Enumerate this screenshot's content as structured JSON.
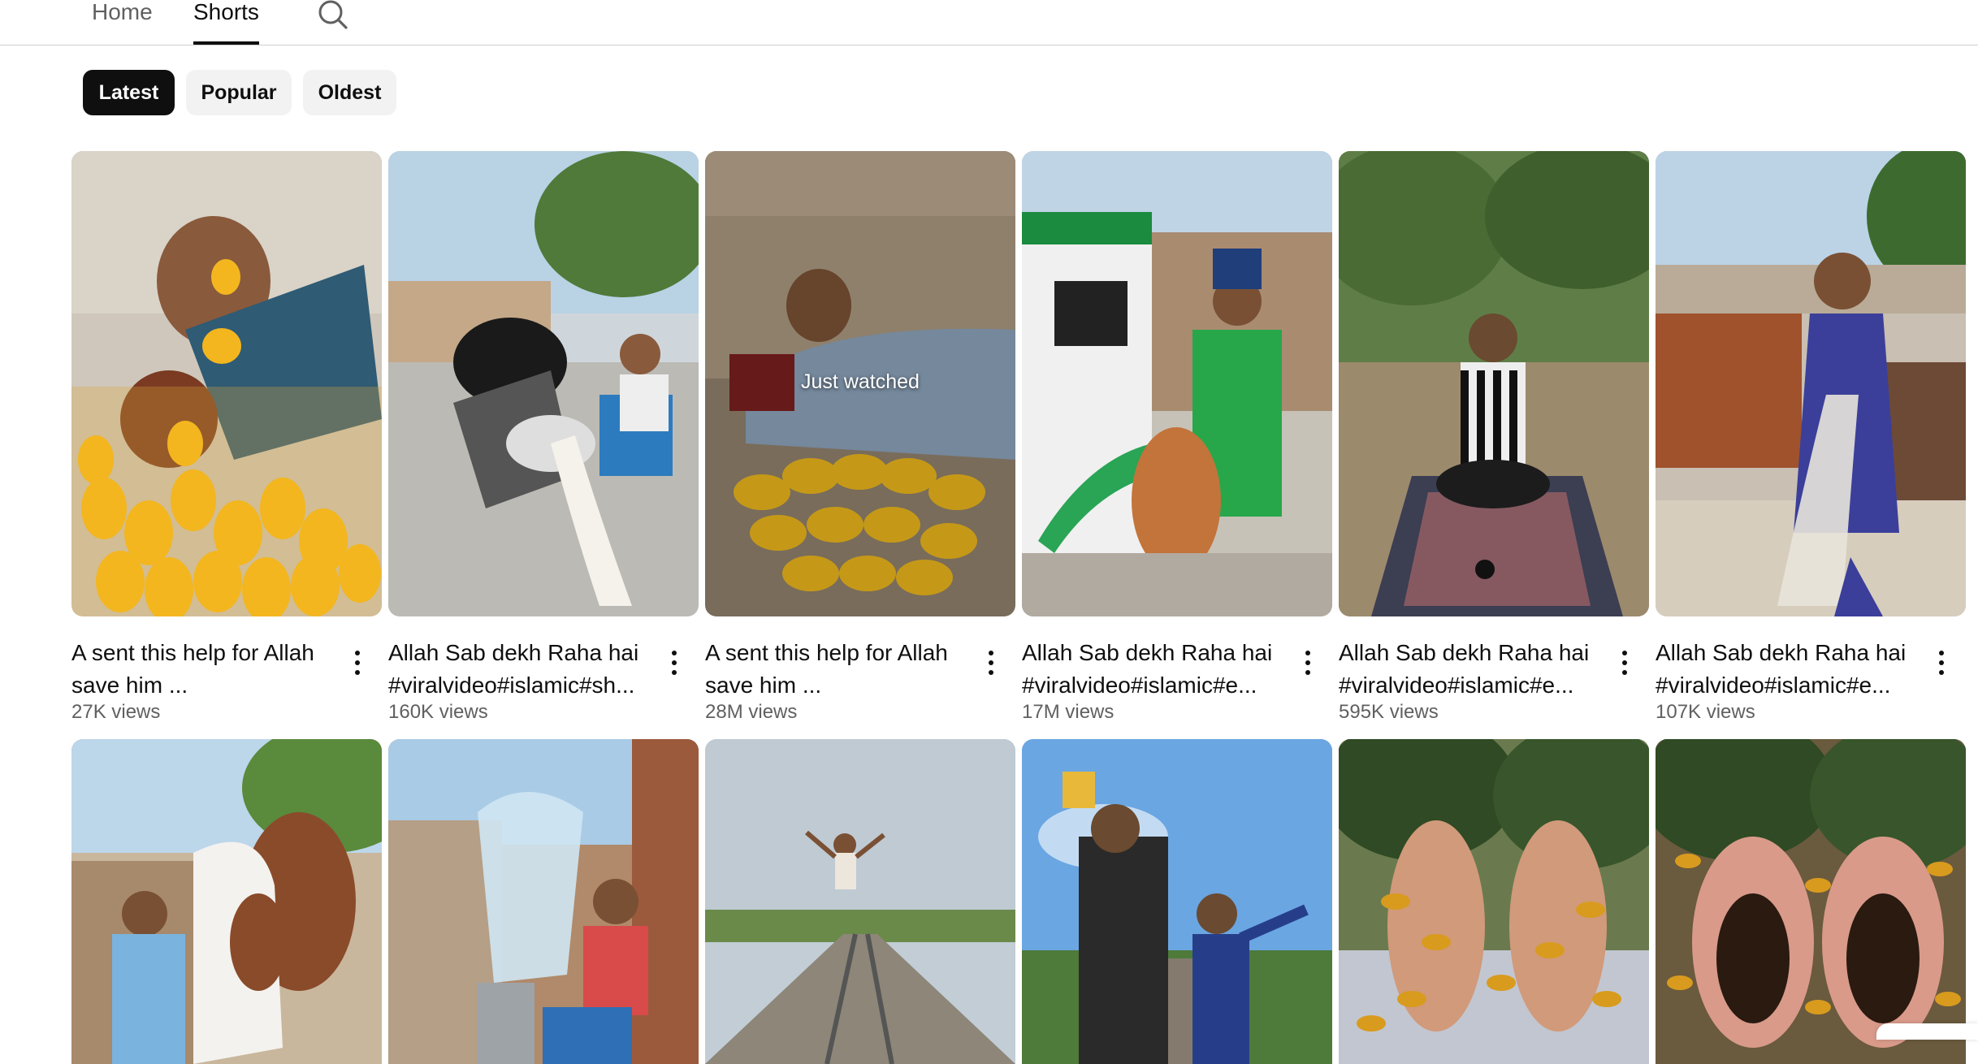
{
  "nav": {
    "tabs": [
      {
        "label": "Home",
        "active": false
      },
      {
        "label": "Shorts",
        "active": true
      }
    ],
    "search_icon": "search-icon"
  },
  "chips": [
    {
      "label": "Latest",
      "active": true
    },
    {
      "label": "Popular",
      "active": false
    },
    {
      "label": "Oldest",
      "active": false
    }
  ],
  "shorts": [
    {
      "title_line1": "A sent this help for Allah",
      "title_line2": "save him ...",
      "views": "27K views"
    },
    {
      "title_line1": "Allah Sab dekh Raha hai",
      "title_line2": "#viralvideo#islamic#sh...",
      "views": "160K views"
    },
    {
      "title_line1": "A sent this help for Allah",
      "title_line2": "save him ...",
      "views": "28M views",
      "overlay": "Just watched"
    },
    {
      "title_line1": "Allah Sab dekh Raha hai",
      "title_line2": "#viralvideo#islamic#e...",
      "views": "17M views"
    },
    {
      "title_line1": "Allah Sab dekh Raha hai",
      "title_line2": "#viralvideo#islamic#e...",
      "views": "595K views"
    },
    {
      "title_line1": "Allah Sab dekh Raha hai",
      "title_line2": "#viralvideo#islamic#e...",
      "views": "107K views"
    }
  ],
  "colors": {
    "text": "#0f0f0f",
    "secondary_text": "#606060",
    "chip_bg": "#f2f2f2",
    "chip_active_bg": "#0f0f0f"
  }
}
